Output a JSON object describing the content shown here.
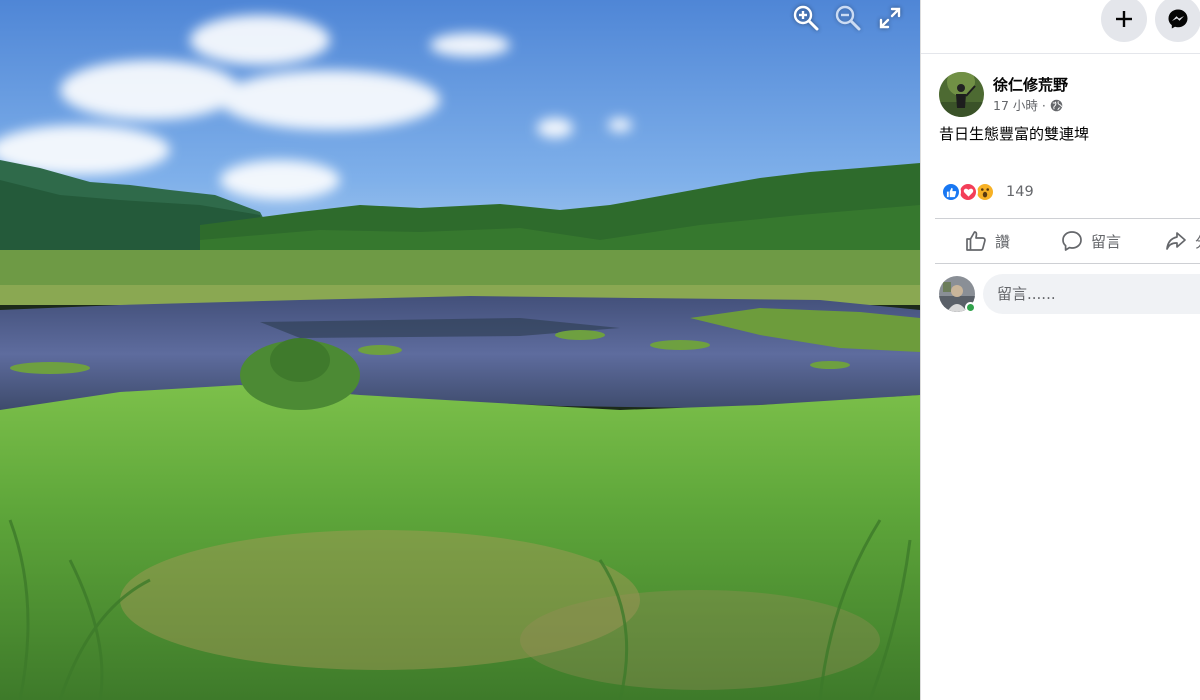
{
  "viewer": {
    "photo_alt": "wetland-landscape",
    "controls": [
      "zoom-in-icon",
      "zoom-out-icon",
      "fullscreen-icon"
    ]
  },
  "topbar": {
    "create_icon": "plus-icon",
    "messenger_icon": "messenger-icon"
  },
  "post": {
    "author": "徐仁修荒野",
    "time": "17 小時",
    "separator": "·",
    "audience_icon": "globe-icon",
    "text": "昔日生態豐富的雙連埤",
    "reactions": [
      "like-reaction-icon",
      "love-reaction-icon",
      "wow-reaction-icon"
    ],
    "reaction_count": "149"
  },
  "actions": {
    "like": "讚",
    "comment": "留言",
    "share": "分"
  },
  "comment_box": {
    "placeholder": "留言......"
  },
  "colors": {
    "accent": "#1877f2",
    "love": "#f33e58",
    "wow": "#f7b125",
    "online": "#31a24c",
    "secondary_text": "#65676b"
  }
}
